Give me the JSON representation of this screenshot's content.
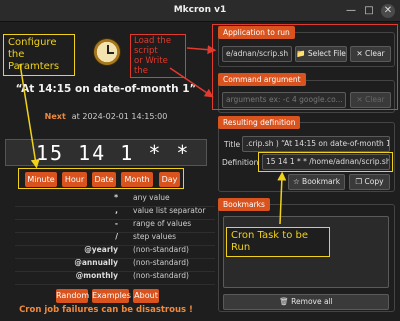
{
  "window": {
    "title": "Mkcron v1",
    "minimize_icon": "minimize-icon",
    "maximize_icon": "maximize-icon",
    "close_icon": "close-icon"
  },
  "left": {
    "human_readable": "“At 14:15 on date-of-month 1”",
    "next_label": "Next",
    "next_value": "at 2024-02-01 14:15:00",
    "expression": "15 14 1 *  *",
    "field_buttons": [
      "Minute",
      "Hour",
      "Date",
      "Month",
      "Day"
    ],
    "help": [
      {
        "symbol": "*",
        "desc": "any value"
      },
      {
        "symbol": ",",
        "desc": "value list separator"
      },
      {
        "symbol": "-",
        "desc": "range of values"
      },
      {
        "symbol": "/",
        "desc": "step values"
      },
      {
        "symbol": "@yearly",
        "desc": "(non-standard)"
      },
      {
        "symbol": "@annually",
        "desc": "(non-standard)"
      },
      {
        "symbol": "@monthly",
        "desc": "(non-standard)"
      }
    ],
    "bottom_buttons": [
      "Random",
      "Examples",
      "About"
    ],
    "warning": "Cron job failures can be disastrous !"
  },
  "right": {
    "app_group_title": "Application to run",
    "app_value": "e/adnan/scrip.sh",
    "select_file_label": "Select File",
    "clear_label": "✕ Clear",
    "arg_group_title": "Command argument",
    "arg_placeholder": "arguments ex: -c 4  google.co...",
    "arg_clear_label": "✕ Clear",
    "result_group_title": "Resulting definition",
    "title_label": "Title",
    "title_value": ".crip.sh ) “At 14:15 on date-of-month 1”",
    "definition_label": "Definition",
    "definition_value": "15 14 1 * * /home/adnan/scrip.sh",
    "bookmark_label": "☆ Bookmark",
    "copy_label": "Copy",
    "bookmarks_group_title": "Bookmarks",
    "remove_all_label": "Remove all"
  },
  "annotations": {
    "configure": "Configure the\nParamters",
    "load_script": "Load the\nscript\nor Write the",
    "cron_task": "Cron Task to be Run"
  },
  "colors": {
    "accent": "#d9531e",
    "annotation_red": "#e13a2e",
    "annotation_yellow": "#f0d21c",
    "background": "#1e1e1e"
  }
}
